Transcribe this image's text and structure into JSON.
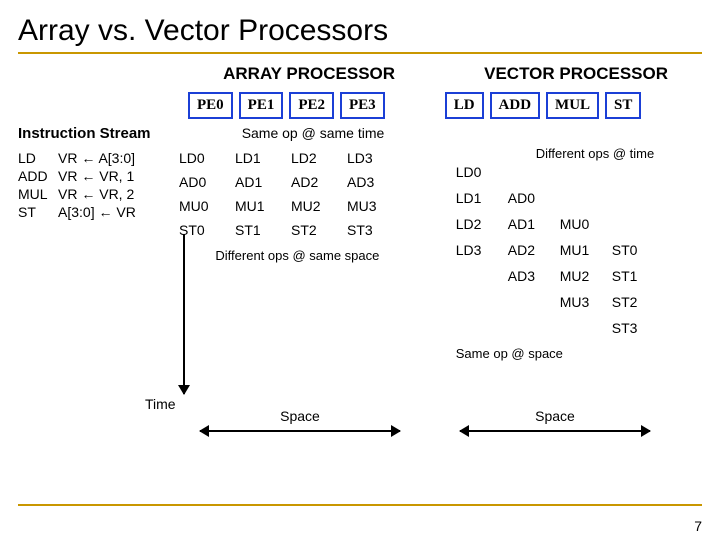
{
  "title": "Array vs. Vector Processors",
  "hdr_array": "ARRAY PROCESSOR",
  "hdr_vector": "VECTOR PROCESSOR",
  "units_array": [
    "PE0",
    "PE1",
    "PE2",
    "PE3"
  ],
  "units_vector": [
    "LD",
    "ADD",
    "MUL",
    "ST"
  ],
  "label_instr_stream": "Instruction Stream",
  "label_same_op_time": "Same op @ same time",
  "label_diff_ops_time": "Different ops @ time",
  "label_diff_ops_space": "Different ops @ same space",
  "label_same_op_space": "Same op @ space",
  "time_label": "Time",
  "space_label": "Space",
  "page": "7",
  "instr": [
    {
      "op": "LD",
      "exp": "VR ← A[3:0]"
    },
    {
      "op": "ADD",
      "exp": "VR ← VR, 1"
    },
    {
      "op": "MUL",
      "exp": "VR ← VR, 2"
    },
    {
      "op": "ST",
      "exp": "A[3:0] ← VR"
    }
  ],
  "array_grid": [
    [
      "LD0",
      "LD1",
      "LD2",
      "LD3"
    ],
    [
      "AD0",
      "AD1",
      "AD2",
      "AD3"
    ],
    [
      "MU0",
      "MU1",
      "MU2",
      "MU3"
    ],
    [
      "ST0",
      "ST1",
      "ST2",
      "ST3"
    ]
  ],
  "vector_grid": [
    [
      "LD0",
      "",
      "",
      ""
    ],
    [
      "LD1",
      "AD0",
      "",
      ""
    ],
    [
      "LD2",
      "AD1",
      "MU0",
      ""
    ],
    [
      "LD3",
      "AD2",
      "MU1",
      "ST0"
    ],
    [
      "",
      "AD3",
      "MU2",
      "ST1"
    ],
    [
      "",
      "",
      "MU3",
      "ST2"
    ],
    [
      "",
      "",
      "",
      "ST3"
    ]
  ]
}
